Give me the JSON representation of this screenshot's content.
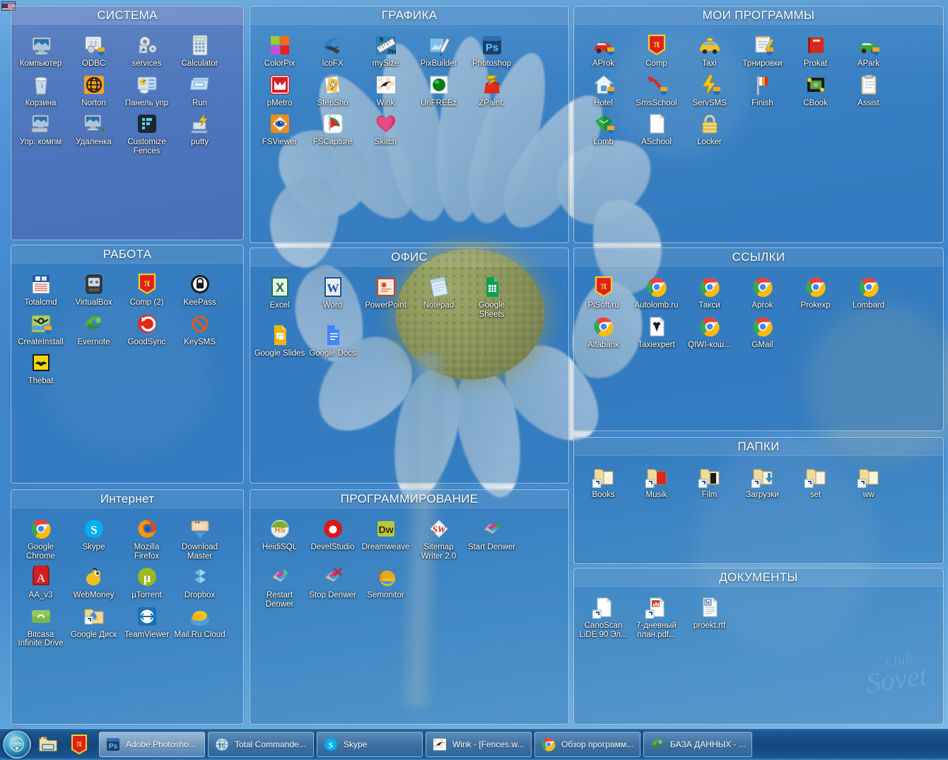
{
  "desktop": {
    "wallpaper_desc": "chamomile-daisy-flower",
    "watermark_top": "club",
    "watermark_bottom": "Sovet",
    "lang_indicator": "EN"
  },
  "fences": [
    {
      "id": "sistema",
      "title": "СИСТЕМА",
      "icons": [
        {
          "label": "Компьютер",
          "icon": "computer-icon"
        },
        {
          "label": "ODBC",
          "icon": "odbc-icon"
        },
        {
          "label": "services",
          "icon": "services-gear-icon"
        },
        {
          "label": "Calculator",
          "icon": "calculator-icon"
        },
        {
          "label": "Корзина",
          "icon": "recycle-bin-icon"
        },
        {
          "label": "Norton",
          "icon": "norton-globe-icon"
        },
        {
          "label": "Панель упр",
          "icon": "control-panel-icon"
        },
        {
          "label": "Run",
          "icon": "run-icon"
        },
        {
          "label": "Упр. компм",
          "icon": "computer-management-icon"
        },
        {
          "label": "Удаленка",
          "icon": "remote-desktop-icon"
        },
        {
          "label": "Customize Fences",
          "icon": "fences-icon"
        },
        {
          "label": "putty",
          "icon": "putty-icon"
        }
      ]
    },
    {
      "id": "grafika",
      "title": "ГРАФИКА",
      "icons": [
        {
          "label": "ColorPix",
          "icon": "colorpix-icon"
        },
        {
          "label": "IcoFX",
          "icon": "icofx-icon"
        },
        {
          "label": "mySize",
          "icon": "mysize-icon"
        },
        {
          "label": "PixBuilder",
          "icon": "pixbuilder-icon"
        },
        {
          "label": "Photoshop",
          "icon": "photoshop-icon"
        },
        {
          "label": "pMetro",
          "icon": "pmetro-icon"
        },
        {
          "label": "StepSho",
          "icon": "stepshot-icon"
        },
        {
          "label": "Wink",
          "icon": "wink-icon"
        },
        {
          "label": "UnFREEz",
          "icon": "unfreez-icon"
        },
        {
          "label": "ZPaint.",
          "icon": "zpaint-icon"
        },
        {
          "label": "FSViewer",
          "icon": "fsviewer-icon"
        },
        {
          "label": "FSCapture",
          "icon": "fscapture-icon"
        },
        {
          "label": "Skitch",
          "icon": "skitch-icon"
        }
      ]
    },
    {
      "id": "moi-programmy",
      "title": "МОИ ПРОГРАММЫ",
      "icons": [
        {
          "label": "AProk",
          "icon": "aprok-car-icon"
        },
        {
          "label": "Comp",
          "icon": "comp-pi-icon"
        },
        {
          "label": "Taxi",
          "icon": "taxi-car-icon"
        },
        {
          "label": "Трнировки",
          "icon": "training-notebook-icon"
        },
        {
          "label": "Prokat",
          "icon": "prokat-book-icon"
        },
        {
          "label": "APark",
          "icon": "apark-car-icon"
        },
        {
          "label": "Hotel",
          "icon": "hotel-house-icon"
        },
        {
          "label": "SmsSchool",
          "icon": "smsschool-icon"
        },
        {
          "label": "ServSMS",
          "icon": "servsms-bolt-icon"
        },
        {
          "label": "Finish",
          "icon": "finish-flag-icon"
        },
        {
          "label": "CBook",
          "icon": "cbook-money-icon"
        },
        {
          "label": "Assist",
          "icon": "assist-clipboard-icon"
        },
        {
          "label": "Lomb",
          "icon": "lomb-gem-icon"
        },
        {
          "label": "ASchool",
          "icon": "aschool-doc-icon"
        },
        {
          "label": "Locker",
          "icon": "locker-padlock-icon"
        }
      ]
    },
    {
      "id": "rabota",
      "title": "РАБОТА",
      "icons": [
        {
          "label": "Totalcmd",
          "icon": "totalcmd-icon"
        },
        {
          "label": "VirtualBox",
          "icon": "virtualbox-icon"
        },
        {
          "label": "Comp (2)",
          "icon": "comp-pi-icon"
        },
        {
          "label": "KeePass",
          "icon": "keepass-icon"
        },
        {
          "label": "CreateInstall",
          "icon": "createinstall-icon"
        },
        {
          "label": "Evernote",
          "icon": "evernote-icon"
        },
        {
          "label": "GoodSync",
          "icon": "goodsync-icon"
        },
        {
          "label": "KeySMS",
          "icon": "keysms-icon"
        },
        {
          "label": "Thebat",
          "icon": "thebat-icon"
        }
      ]
    },
    {
      "id": "ofis",
      "title": "ОФИС",
      "icons": [
        {
          "label": "Excel",
          "icon": "excel-icon"
        },
        {
          "label": "Word",
          "icon": "word-icon"
        },
        {
          "label": "PowerPoint",
          "icon": "powerpoint-icon"
        },
        {
          "label": "Notepad",
          "icon": "notepad-icon"
        },
        {
          "label": "Google Sheets",
          "icon": "google-sheets-icon"
        },
        {
          "label": "Google Slides",
          "icon": "google-slides-icon"
        },
        {
          "label": "Google Docs",
          "icon": "google-docs-icon"
        }
      ]
    },
    {
      "id": "ssylki",
      "title": "ССЫЛКИ",
      "icons": [
        {
          "label": "PiSoft.ru",
          "icon": "pisoft-pi-icon"
        },
        {
          "label": "Autolomb.ru",
          "icon": "chrome-icon"
        },
        {
          "label": "Такси",
          "icon": "chrome-icon"
        },
        {
          "label": "Aprok",
          "icon": "chrome-icon"
        },
        {
          "label": "Prokexp",
          "icon": "chrome-icon"
        },
        {
          "label": "Lombard",
          "icon": "chrome-icon"
        },
        {
          "label": "Alfabank",
          "icon": "chrome-icon"
        },
        {
          "label": "Taxiexpert",
          "icon": "taxiexpert-doc-icon"
        },
        {
          "label": "QIWI-кош...",
          "icon": "chrome-icon"
        },
        {
          "label": "GMail",
          "icon": "chrome-icon"
        }
      ]
    },
    {
      "id": "papki",
      "title": "ПАПКИ",
      "icons": [
        {
          "label": "Books",
          "icon": "folder-shortcut-icon"
        },
        {
          "label": "Musik",
          "icon": "folder-music-shortcut-icon"
        },
        {
          "label": "Film",
          "icon": "folder-film-shortcut-icon"
        },
        {
          "label": "Загрузки",
          "icon": "folder-downloads-shortcut-icon"
        },
        {
          "label": "set",
          "icon": "folder-shortcut-icon"
        },
        {
          "label": "ww",
          "icon": "folder-shortcut-icon"
        }
      ]
    },
    {
      "id": "dokumenty",
      "title": "ДОКУМЕНТЫ",
      "icons": [
        {
          "label": "CanoScan LiDE 90 Эл...",
          "icon": "document-shortcut-icon"
        },
        {
          "label": "7-дневный план.pdf...",
          "icon": "pdf-shortcut-icon"
        },
        {
          "label": "proekt.rtf",
          "icon": "rtf-document-icon"
        }
      ]
    },
    {
      "id": "internet",
      "title": "Интернет",
      "icons": [
        {
          "label": "Google Chrome",
          "icon": "chrome-icon"
        },
        {
          "label": "Skype",
          "icon": "skype-icon"
        },
        {
          "label": "Mozilla Firefox",
          "icon": "firefox-icon"
        },
        {
          "label": "Download Master",
          "icon": "download-master-icon"
        },
        {
          "label": "AA_v3",
          "icon": "aa-v3-icon"
        },
        {
          "label": "WebMoney",
          "icon": "webmoney-icon"
        },
        {
          "label": "µTorrent",
          "icon": "utorrent-icon"
        },
        {
          "label": "Dropbox",
          "icon": "dropbox-icon"
        },
        {
          "label": "Bitcasa Infinite Drive",
          "icon": "bitcasa-icon"
        },
        {
          "label": "Google Диск",
          "icon": "google-drive-icon"
        },
        {
          "label": "TeamViewer",
          "icon": "teamviewer-icon"
        },
        {
          "label": "Mail.Ru Cloud",
          "icon": "mailru-cloud-icon"
        }
      ]
    },
    {
      "id": "programmirovanie",
      "title": "ПРОГРАММИРОВАНИЕ",
      "icons": [
        {
          "label": "HeidiSQL",
          "icon": "heidisql-icon"
        },
        {
          "label": "DevelStudio",
          "icon": "develstudio-icon"
        },
        {
          "label": "Dreamweave",
          "icon": "dreamweaver-icon"
        },
        {
          "label": "Sitemap Writer 2.0",
          "icon": "sitemap-writer-icon"
        },
        {
          "label": "Start Denwer",
          "icon": "start-denwer-icon"
        },
        {
          "label": "Restart Denwer",
          "icon": "restart-denwer-icon"
        },
        {
          "label": "Stop Denwer",
          "icon": "stop-denwer-icon"
        },
        {
          "label": "Semonitor",
          "icon": "semonitor-icon"
        }
      ]
    }
  ],
  "taskbar": {
    "start_label": "Start",
    "quick_launch": [
      {
        "name": "explorer-quicklaunch",
        "icon": "folder-explorer-icon"
      },
      {
        "name": "comp-quicklaunch",
        "icon": "comp-pi-icon"
      }
    ],
    "buttons": [
      {
        "label": "Adobe Photosho...",
        "icon": "photoshop-icon",
        "active": true
      },
      {
        "label": "Total Commande...",
        "icon": "totalcmd-globe-icon",
        "active": false
      },
      {
        "label": "Skype",
        "icon": "skype-icon",
        "active": false
      },
      {
        "label": "Wink - [Fences.w...",
        "icon": "wink-icon",
        "active": false
      },
      {
        "label": "Обзор программ...",
        "icon": "chrome-icon",
        "active": false
      },
      {
        "label": "БАЗА ДАННЫХ - ...",
        "icon": "evernote-icon",
        "active": false
      }
    ]
  },
  "colors": {
    "fence_bg": "#266EAF",
    "fence_bg_purple": "#5052A0",
    "taskbar": "#15467D",
    "accent": "#3A86C8"
  }
}
